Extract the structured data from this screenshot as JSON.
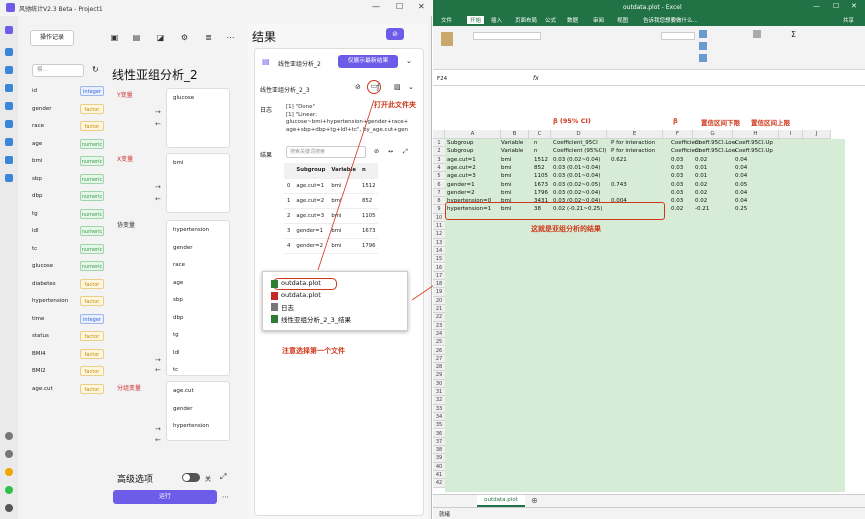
{
  "left_app": {
    "title": "风驰统计V2.3 Beta - Project1",
    "toolbar": {
      "log_button": "操作记录"
    },
    "search_placeholder": "模...",
    "variables": [
      {
        "name": "id",
        "type": "integer"
      },
      {
        "name": "gender",
        "type": "factor"
      },
      {
        "name": "race",
        "type": "factor"
      },
      {
        "name": "age",
        "type": "numeric"
      },
      {
        "name": "bmi",
        "type": "numeric"
      },
      {
        "name": "sbp",
        "type": "numeric"
      },
      {
        "name": "dbp",
        "type": "numeric"
      },
      {
        "name": "tg",
        "type": "numeric"
      },
      {
        "name": "ldl",
        "type": "numeric"
      },
      {
        "name": "tc",
        "type": "numeric"
      },
      {
        "name": "glucose",
        "type": "numeric"
      },
      {
        "name": "diabetes",
        "type": "factor"
      },
      {
        "name": "hypertension",
        "type": "factor"
      },
      {
        "name": "time",
        "type": "integer"
      },
      {
        "name": "status",
        "type": "factor"
      },
      {
        "name": "BMI4",
        "type": "factor"
      },
      {
        "name": "BMI2",
        "type": "factor"
      },
      {
        "name": "age.cut",
        "type": "factor"
      }
    ],
    "analysis_title": "线性亚组分析_2",
    "y_label": "Y变量",
    "y_vars": [
      "glucose"
    ],
    "x_label": "X变量",
    "x_vars": [
      "bmi"
    ],
    "cov_label": "协变量",
    "cov_vars": [
      "hypertension",
      "gender",
      "race",
      "age",
      "sbp",
      "dbp",
      "tg",
      "ldl",
      "tc"
    ],
    "group_label": "分组变量",
    "group_vars": [
      "age.cut",
      "gender",
      "hypertension"
    ],
    "advanced": "高级选项",
    "toggle_state": "关",
    "run": "运行"
  },
  "result": {
    "title": "结果",
    "item_name": "线性亚组分析_2",
    "show_latest": "仅展示最新结果",
    "sub_name": "线性亚组分析_2_3",
    "log_label": "日志",
    "log_lines": [
      "[1] \"Done\"",
      "[1] \"Linear:",
      "glucose~bmi+hypertension+gender+race+",
      "age+sbp+dbp+tg+ldl+tc\", by_age.cut+gen"
    ],
    "result_label": "结果",
    "search_placeholder": "搜索关键词搜索",
    "table_headers": [
      "",
      "Subgroup",
      "Variable",
      "n"
    ],
    "table_rows": [
      [
        "0",
        "age.cut=1",
        "bmi",
        "1512"
      ],
      [
        "1",
        "age.cut=2",
        "bmi",
        "852"
      ],
      [
        "2",
        "age.cut=3",
        "bmi",
        "1105"
      ],
      [
        "3",
        "gender=1",
        "bmi",
        "1673"
      ],
      [
        "4",
        "gender=2",
        "bmi",
        "1796"
      ]
    ]
  },
  "popup": {
    "items": [
      "outdata.plot",
      "outdata.plot",
      "日志",
      "线性亚组分析_2_3_结果"
    ]
  },
  "annotations": {
    "open_folder": "打开此文件夹",
    "choose_first": "注意选择第一个文件",
    "result_note": "这就是亚组分析的结果",
    "beta_ci": "β (95% CI)",
    "beta": "β",
    "ci_low": "置信区间下限",
    "ci_up": "置信区间上限"
  },
  "excel": {
    "title": "outdata.plot - Excel",
    "menu": [
      "文件",
      "开始",
      "插入",
      "页面布局",
      "公式",
      "数据",
      "审阅",
      "视图",
      "告诉我您想要做什么..."
    ],
    "share": "共享",
    "name_box": "F24",
    "columns": [
      "A",
      "B",
      "C",
      "D",
      "E",
      "F",
      "G",
      "H",
      "I",
      "J"
    ],
    "rows": [
      [
        "Subgroup",
        "Variable",
        "n",
        "Coefficient_95CI",
        "P for interaction",
        "Coefficient",
        "Coeff.95CI.Low",
        "Coeff.95CI.Up"
      ],
      [
        "Subgroup",
        "Variable",
        "n",
        "Coefficient (95%CI)",
        "P for interaction",
        "Coefficient",
        "Coeff.95CI.Low",
        "Coeff.95CI.Up"
      ],
      [
        "age.cut=1",
        "bmi",
        "1512",
        "0.03 (0.02~0.04)",
        "0.621",
        "0.03",
        "0.02",
        "0.04"
      ],
      [
        "age.cut=2",
        "bmi",
        "852",
        "0.03 (0.01~0.04)",
        "",
        "0.03",
        "0.01",
        "0.04"
      ],
      [
        "age.cut=3",
        "bmi",
        "1105",
        "0.03 (0.01~0.04)",
        "",
        "0.03",
        "0.01",
        "0.04"
      ],
      [
        "gender=1",
        "bmi",
        "1673",
        "0.03 (0.02~0.05)",
        "0.743",
        "0.03",
        "0.02",
        "0.05"
      ],
      [
        "gender=2",
        "bmi",
        "1796",
        "0.03 (0.02~0.04)",
        "",
        "0.03",
        "0.02",
        "0.04"
      ],
      [
        "hypertension=0",
        "bmi",
        "3431",
        "0.03 (0.02~0.04)",
        "0.004",
        "0.03",
        "0.02",
        "0.04"
      ],
      [
        "hypertension=1",
        "bmi",
        "38",
        "0.02 (-0.21~0.25)",
        "",
        "0.02",
        "-0.21",
        "0.25"
      ]
    ],
    "sheet_tab": "outdata.plot",
    "status": "就绪"
  }
}
